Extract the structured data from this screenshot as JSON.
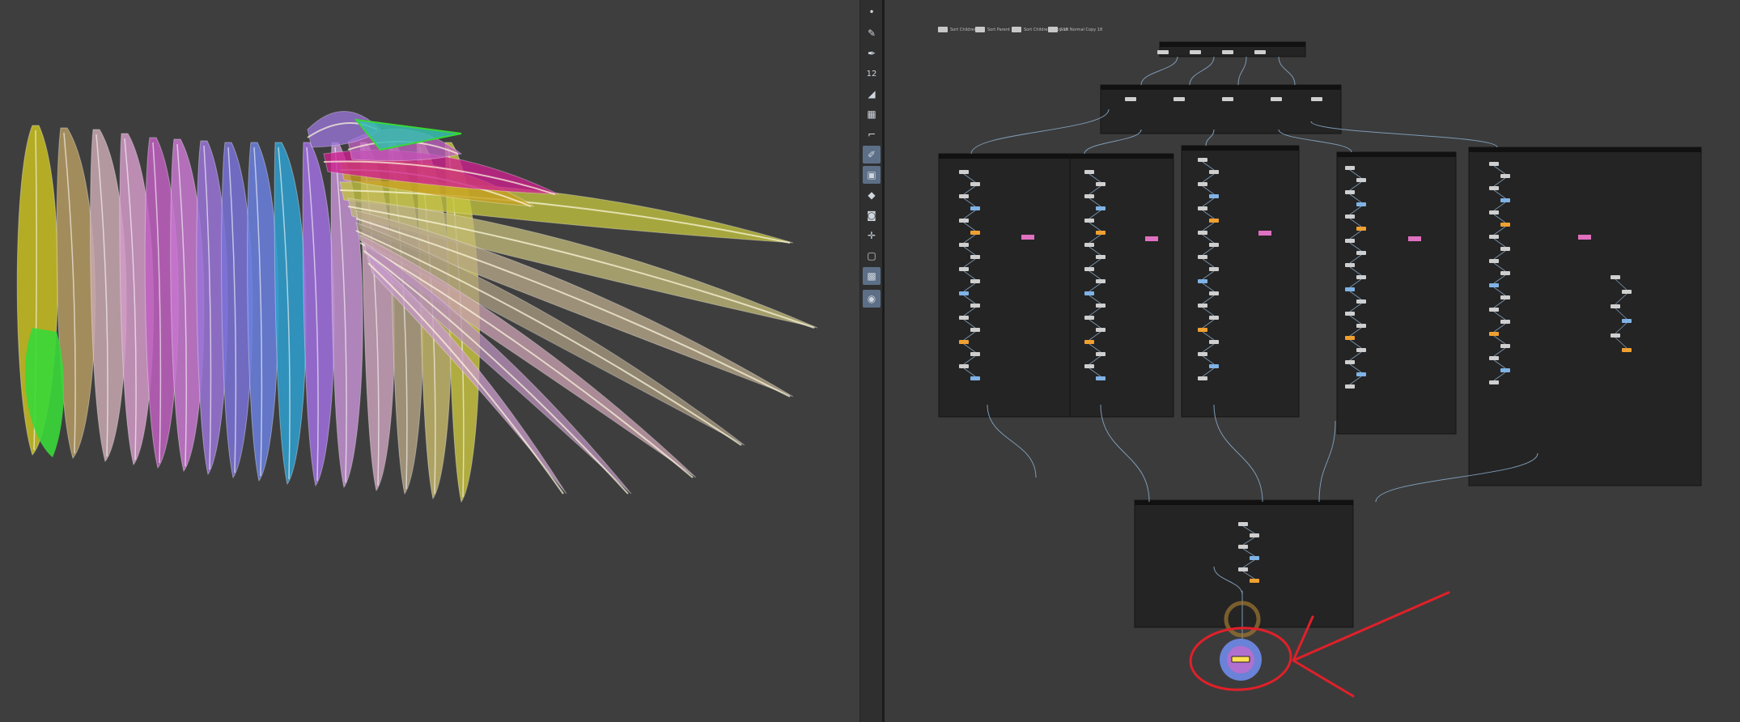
{
  "toolbar": {
    "tools": [
      {
        "name": "select-dot-icon",
        "glyph": "•",
        "active": false
      },
      {
        "name": "brush-icon",
        "glyph": "✎",
        "active": false
      },
      {
        "name": "pen-icon",
        "glyph": "✒",
        "active": false
      },
      {
        "name": "counter-icon",
        "glyph": "12",
        "active": false
      },
      {
        "name": "eraser-icon",
        "glyph": "◢",
        "active": false
      },
      {
        "name": "stamp-icon",
        "glyph": "▦",
        "active": false
      },
      {
        "name": "ruler-icon",
        "glyph": "⌐",
        "active": false
      },
      {
        "name": "draw-mode-icon",
        "glyph": "✐",
        "active": true
      },
      {
        "name": "grid-view-icon",
        "glyph": "▣",
        "active": true
      },
      {
        "name": "diamond-icon",
        "glyph": "◆",
        "active": false
      },
      {
        "name": "camera-icon",
        "glyph": "◙",
        "active": false
      },
      {
        "name": "axis-icon",
        "glyph": "✛",
        "active": false
      },
      {
        "name": "display-icon",
        "glyph": "▢",
        "active": false
      },
      {
        "name": "render-view-icon",
        "glyph": "▩",
        "active": true
      },
      {
        "name": "light-bulb-icon",
        "glyph": "◉",
        "active": true
      }
    ]
  },
  "network": {
    "legend": [
      "Sort Children",
      "Sort Parent",
      "Sort Children Copy 18",
      "Sort Normal Copy 18"
    ],
    "colors": {
      "node": "#cfcfcf",
      "node_blue": "#7fb3e6",
      "node_orange": "#f0a030",
      "node_pink": "#e070c0",
      "wire": "#7e9ab5",
      "subnet_bg": "#242424",
      "annotation": "#e0202a",
      "output_ring": "#6a82d8",
      "output_inner": "#b070d0",
      "output_node": "#ffe050",
      "highlight": "#a07830"
    }
  },
  "viewport": {
    "feather_colors": [
      "#c9c020",
      "#b59a60",
      "#c9a8b0",
      "#d29ac8",
      "#c060c0",
      "#c878d0",
      "#9a74d8",
      "#7a72d8",
      "#6a80e0",
      "#2ea0d0",
      "#a070e0",
      "#c290d0",
      "#c8a0b8",
      "#ae9f80",
      "#c2b46a",
      "#c4c040",
      "#bcc028"
    ],
    "accent_colors": [
      "#38d838",
      "#36c0b0"
    ]
  }
}
